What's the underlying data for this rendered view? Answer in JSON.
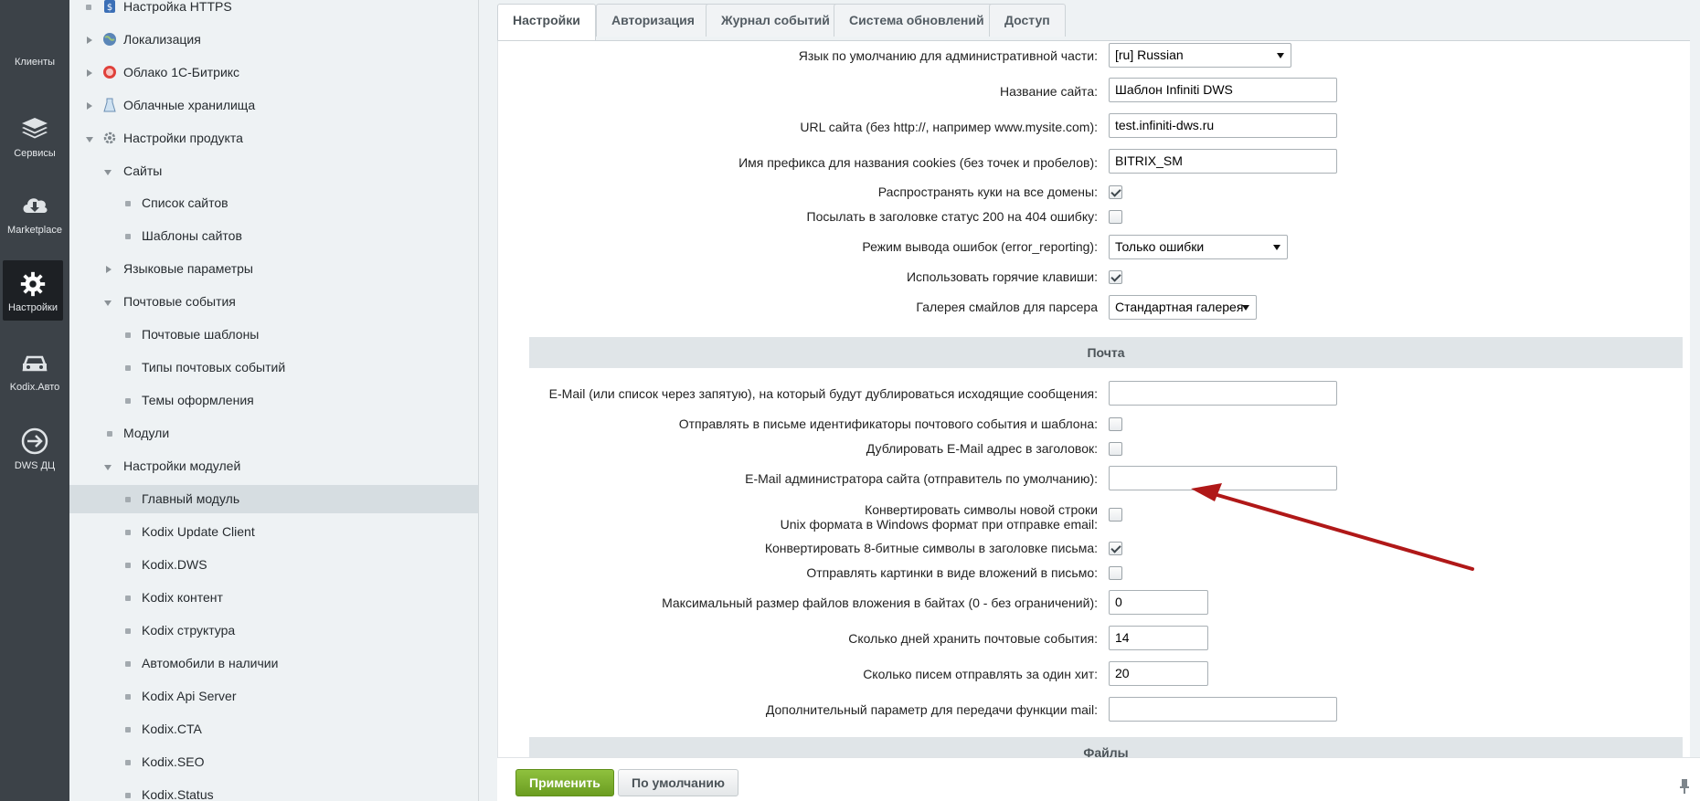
{
  "leftbar": {
    "items": [
      {
        "label": "Клиенты",
        "icon": "clients-icon"
      },
      {
        "label": "Сервисы",
        "icon": "layers-icon"
      },
      {
        "label": "Marketplace",
        "icon": "cloud-download-icon"
      },
      {
        "label": "Настройки",
        "icon": "gear-icon"
      },
      {
        "label": "Kodix.Авто",
        "icon": "car-icon"
      },
      {
        "label": "DWS ДЦ",
        "icon": "arrow-circle-icon"
      }
    ]
  },
  "tree": {
    "items": [
      {
        "label": "Настройка HTTPS"
      },
      {
        "label": "Локализация"
      },
      {
        "label": "Облако 1С-Битрикс"
      },
      {
        "label": "Облачные хранилища"
      },
      {
        "label": "Настройки продукта"
      },
      {
        "label": "Сайты"
      },
      {
        "label": "Список сайтов"
      },
      {
        "label": "Шаблоны сайтов"
      },
      {
        "label": "Языковые параметры"
      },
      {
        "label": "Почтовые события"
      },
      {
        "label": "Почтовые шаблоны"
      },
      {
        "label": "Типы почтовых событий"
      },
      {
        "label": "Темы оформления"
      },
      {
        "label": "Модули"
      },
      {
        "label": "Настройки модулей"
      },
      {
        "label": "Главный модуль"
      },
      {
        "label": "Kodix Update Client"
      },
      {
        "label": "Kodix.DWS"
      },
      {
        "label": "Kodix контент"
      },
      {
        "label": "Kodix структура"
      },
      {
        "label": "Автомобили в наличии"
      },
      {
        "label": "Kodix Api Server"
      },
      {
        "label": "Kodix.CTA"
      },
      {
        "label": "Kodix.SEO"
      },
      {
        "label": "Kodix.Status"
      }
    ]
  },
  "tabs": [
    {
      "label": "Настройки"
    },
    {
      "label": "Авторизация"
    },
    {
      "label": "Журнал событий"
    },
    {
      "label": "Система обновлений"
    },
    {
      "label": "Доступ"
    }
  ],
  "form": {
    "admin_lang_label": "Язык по умолчанию для административной части:",
    "admin_lang_value": "[ru] Russian",
    "site_name_label": "Название сайта:",
    "site_name_value": "Шаблон Infiniti DWS",
    "site_url_label": "URL сайта (без http://, например www.mysite.com):",
    "site_url_value": "test.infiniti-dws.ru",
    "cookie_prefix_label": "Имя префикса для названия cookies (без точек и пробелов):",
    "cookie_prefix_value": "BITRIX_SM",
    "cookie_all_domains_label": "Распространять куки на все домены:",
    "status_200_label": "Посылать в заголовке статус 200 на 404 ошибку:",
    "error_reporting_label": "Режим вывода ошибок (error_reporting):",
    "error_reporting_value": "Только ошибки",
    "hotkeys_label": "Использовать горячие клавиши:",
    "smiles_label": "Галерея смайлов для парсера",
    "smiles_value": "Стандартная галерея",
    "mail_section": "Почта",
    "dup_email_label": "E-Mail (или список через запятую), на который будут дублироваться исходящие сообщения:",
    "dup_email_value": "",
    "send_ids_label": "Отправлять в письме идентификаторы почтового события и шаблона:",
    "dup_header_label": "Дублировать E-Mail адрес в заголовок:",
    "admin_email_label": "E-Mail администратора сайта (отправитель по умолчанию):",
    "admin_email_value": "",
    "convert_newline_label_1": "Конвертировать символы новой строки",
    "convert_newline_label_2": "Unix формата в Windows формат при отправке email:",
    "convert_8bit_label": "Конвертировать 8-битные символы в заголовке письма:",
    "send_images_label": "Отправлять картинки в виде вложений в письмо:",
    "max_attach_label": "Максимальный размер файлов вложения в байтах (0 - без ограничений):",
    "max_attach_value": "0",
    "keep_days_label": "Сколько дней хранить почтовые события:",
    "keep_days_value": "14",
    "per_hit_label": "Сколько писем отправлять за один хит:",
    "per_hit_value": "20",
    "mail_param_label": "Дополнительный параметр для передачи функции mail:",
    "mail_param_value": "",
    "files_section": "Файлы"
  },
  "checkboxes": {
    "cookie_all_domains": true,
    "status_200": false,
    "hotkeys": true,
    "send_ids": false,
    "dup_header": false,
    "convert_newline": false,
    "convert_8bit": true,
    "send_images": false
  },
  "buttons": {
    "apply": "Применить",
    "default": "По умолчанию"
  },
  "colors": {
    "leftbar": "#3c4248",
    "apply": "#7aad2c",
    "annotation_arrow": "#b01818"
  }
}
